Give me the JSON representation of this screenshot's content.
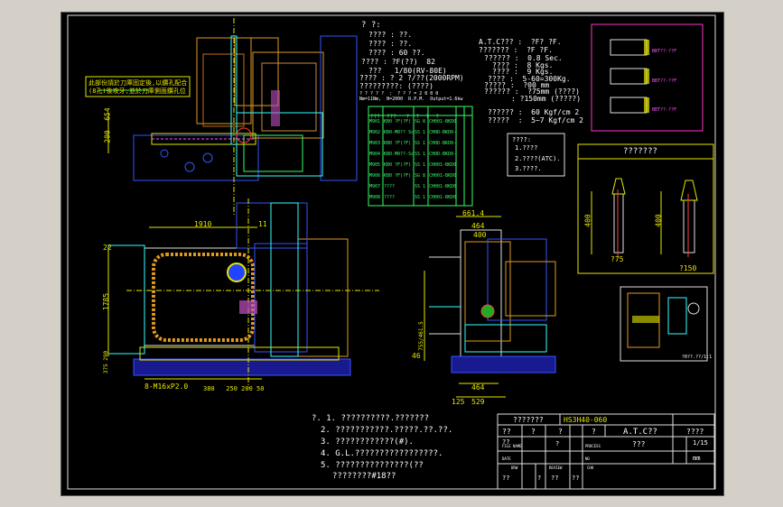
{
  "header": {
    "title": "? ?:",
    "spec_left": [
      "???? : ??.",
      "???? : ??.",
      "???? : 60 ??.",
      "???? : ?F(??)  82",
      "???   1/80(RV-80E)",
      "???? : ? 2 ?/??(2000RPM)",
      "?????????: (????)"
    ],
    "spec_small": [
      "? ? ? ? ?  :  ? ? ? = 2 0 0 0",
      "Nm=11Nm,  N=2000  R.P.M.  Output=1.6kw"
    ],
    "spec_right": [
      "A.T.C??? :  ?F? ?F.",
      "??????? :  ?F ?F.",
      "?????? :  0.8 Sec.",
      "???? :  8 Kgs.",
      "???? :  9 Kgs.",
      "???? :  5-60=300Kg.",
      "????? :  ?00 mm",
      "?????? :  ?75mm (????)",
      ": ?150mm (?????)"
    ],
    "pressure": [
      "?????? :  60 Kgf/cm 2",
      "?????  :  5~7 Kgf/cm 2"
    ]
  },
  "note_box": [
    "????:",
    "1.????",
    "2.????(ATC).",
    "3.????."
  ],
  "chinese_label": [
    "此部份請於刀庫固定後,以鑽孔配合",
    "(8孔)後攻牙,並於刀庫側面鑽孔位"
  ],
  "table": {
    "cols": [
      "???",
      "???",
      "?",
      "?",
      "?",
      "?"
    ],
    "rows": [
      [
        "M901",
        "KB0 ?F(?F) ?-?, ?",
        "SG 8",
        "CH001-BKD0-1",
        ""
      ],
      [
        "M902",
        "KB0-M0?? Scene ? (?F?)",
        "SS 1",
        "CH0D-BKD0-8",
        ""
      ],
      [
        "M903",
        "KB0 ?F(?F) (BKD0?) ? ?",
        "SS 1",
        "CH0D-BKD0-2",
        ""
      ],
      [
        "M904",
        "KB0-M0??-Scene ? (?F ?)",
        "SS 1",
        "CH0D-BKD0-3",
        ""
      ],
      [
        "M905",
        "KB0 ?F(?F) (BKD0?) ??",
        "SS 1",
        "CH001-BKD0-9",
        ""
      ],
      [
        "M906",
        "KB0 ?F(?F) ? ?",
        "SG 8",
        "CH001-BKD0-4",
        ""
      ],
      [
        "M907",
        "????",
        "SS 1",
        "CH001-BKD0-1",
        ""
      ],
      [
        "M908",
        "????",
        "SS 1",
        "CH001-BKD0-2",
        ""
      ]
    ]
  },
  "dims": {
    "top_654": "654",
    "top_200": "200",
    "plan_1910": "1910",
    "plan_11": "11",
    "plan_1785": "1785",
    "plan_22": "22",
    "plan_375": "375 290",
    "plan_bottom": "380   250 200 50",
    "plan_thread": "8-M16xP2.0",
    "side_6614": "661.4",
    "side_464": "464",
    "side_400": "400",
    "side_755": "755/461.5",
    "side_46": "46",
    "side_464b": "464",
    "side_529": "529",
    "side_125": "125"
  },
  "tool_box": {
    "title": "???????",
    "dim_left": "400",
    "dim_right": "400",
    "dia_left": "?75",
    "dia_right": "?150"
  },
  "magenta_box": {
    "labels": [
      "BBT??-??F",
      "BBT??-??F",
      "BBT??-??F"
    ]
  },
  "detail_label": "?0??.??/1:1",
  "notes": [
    "?. 1. ??????????.???????",
    "2. ???????????.?????.??.??.",
    "3. ????????????(#).",
    "4. G.L.?????????????????.",
    "5. ???????????????(??",
    "????????#18??"
  ],
  "title_block": {
    "name": "???????",
    "code": "HS3H40-060",
    "r1": [
      "??",
      "?",
      "?",
      "?"
    ],
    "atc": "A.T.C??",
    "r1_right": "????",
    "r2_small": [
      "FILE NAME",
      "PROCESS"
    ],
    "r2": [
      "??",
      "?",
      "???"
    ],
    "scale": "1/15",
    "date": "DATE",
    "no": "NO",
    "unit": "mm",
    "r4_small": [
      "DRW",
      "REVIEW",
      "CHK"
    ],
    "r4": [
      "??",
      "?",
      "??",
      "??"
    ]
  },
  "colors": {
    "frame": "#8080ff",
    "yellow": "#e6e600",
    "green": "#33ff66",
    "cyan": "#33ffff",
    "orange": "#e09a20",
    "blue": "#3355ff",
    "magenta": "#ff33cc"
  }
}
